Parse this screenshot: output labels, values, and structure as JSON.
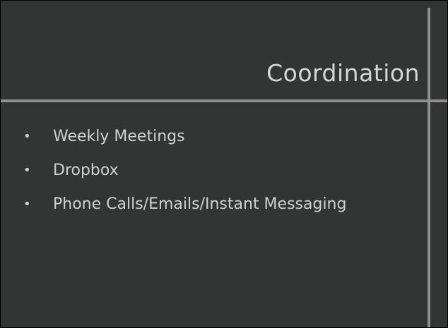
{
  "slide": {
    "title": "Coordination",
    "bullets": [
      "Weekly Meetings",
      "Dropbox",
      "Phone Calls/Emails/Instant Messaging"
    ],
    "bullet_glyph": "•"
  },
  "colors": {
    "background": "#333434",
    "accent_lines": "#8f8f8f",
    "text": "#d7d7d7"
  }
}
